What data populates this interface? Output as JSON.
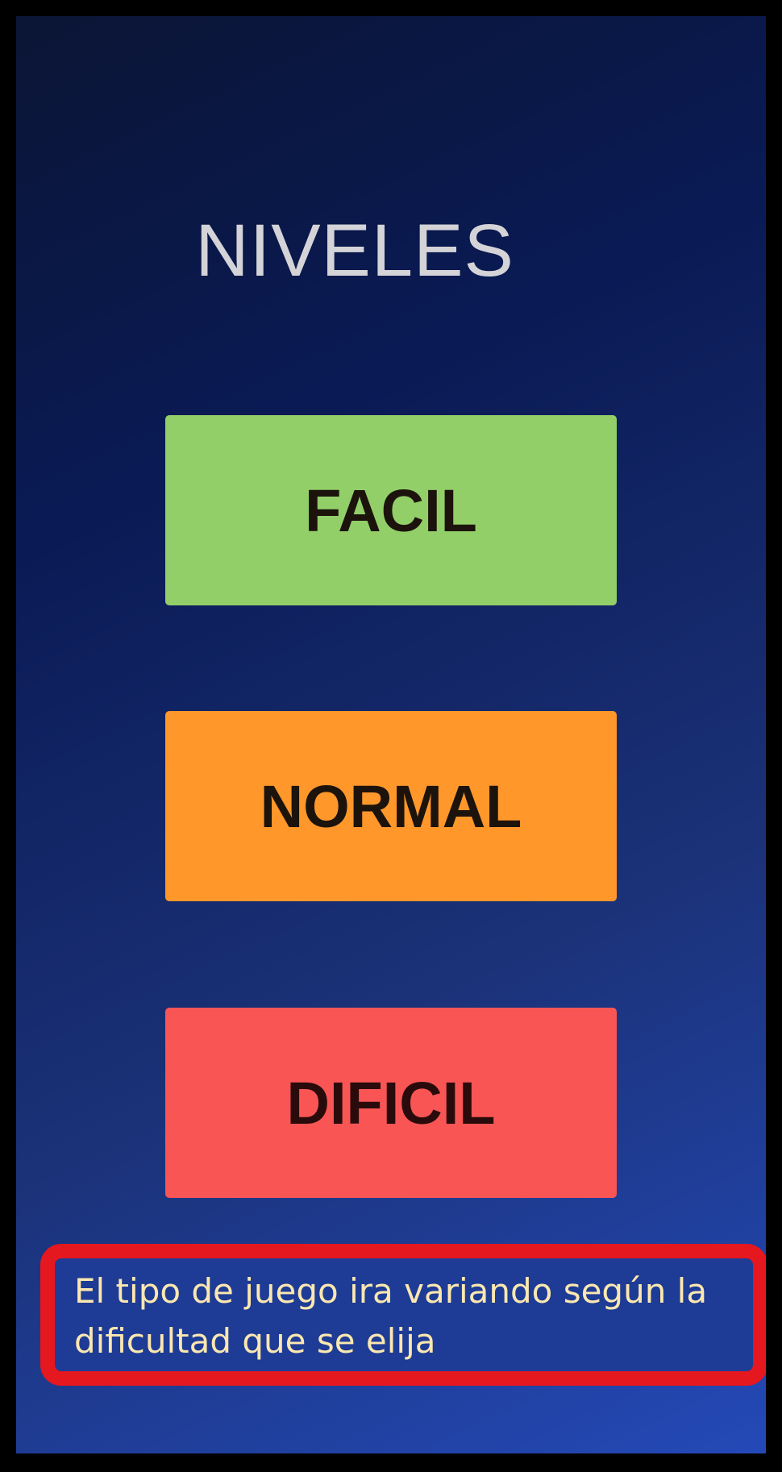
{
  "screen": {
    "title": "NIVELES"
  },
  "levels": [
    {
      "label": "FACIL",
      "color": "#92cf68"
    },
    {
      "label": "NORMAL",
      "color": "#ff972b"
    },
    {
      "label": "DIFICIL",
      "color": "#fa5555"
    }
  ],
  "note": {
    "text": "El tipo de juego ira variando según la dificultad que se elija",
    "highlight_color": "#e5171f"
  }
}
